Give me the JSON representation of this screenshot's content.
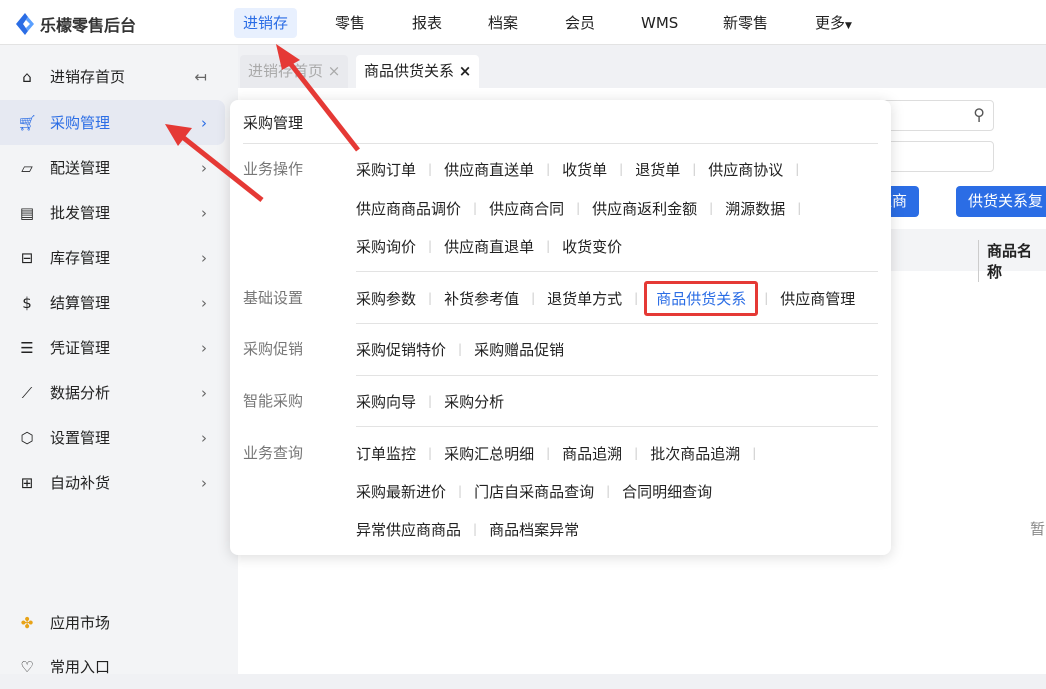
{
  "app": {
    "title": "乐檬零售后台"
  },
  "topnav": [
    "进销存",
    "零售",
    "报表",
    "档案",
    "会员",
    "WMS",
    "新零售",
    "更多"
  ],
  "sidebar": {
    "items": [
      "进销存首页",
      "采购管理",
      "配送管理",
      "批发管理",
      "库存管理",
      "结算管理",
      "凭证管理",
      "数据分析",
      "设置管理",
      "自动补货"
    ],
    "bottom": [
      "应用市场",
      "常用入口"
    ]
  },
  "tabs": [
    "进销存首页",
    "商品供货关系"
  ],
  "background": {
    "buttons": [
      "供应商",
      "供货关系复"
    ],
    "column": "商品名称",
    "empty": "暂"
  },
  "popup": {
    "title": "采购管理",
    "groups": [
      {
        "label": "业务操作",
        "lines": [
          [
            "采购订单",
            "供应商直送单",
            "收货单",
            "退货单",
            "供应商协议"
          ],
          [
            "供应商商品调价",
            "供应商合同",
            "供应商返利金额",
            "溯源数据"
          ],
          [
            "采购询价",
            "供应商直退单",
            "收货变价"
          ]
        ]
      },
      {
        "label": "基础设置",
        "lines": [
          [
            "采购参数",
            "补货参考值",
            "退货单方式",
            "商品供货关系",
            "供应商管理"
          ]
        ]
      },
      {
        "label": "采购促销",
        "lines": [
          [
            "采购促销特价",
            "采购赠品促销"
          ]
        ]
      },
      {
        "label": "智能采购",
        "lines": [
          [
            "采购向导",
            "采购分析"
          ]
        ]
      },
      {
        "label": "业务查询",
        "lines": [
          [
            "订单监控",
            "采购汇总明细",
            "商品追溯",
            "批次商品追溯"
          ],
          [
            "采购最新进价",
            "门店自采商品查询",
            "合同明细查询"
          ],
          [
            "异常供应商商品",
            "商品档案异常"
          ]
        ]
      }
    ]
  },
  "colors": {
    "accent": "#2b6de5",
    "highlight": "#e53935"
  }
}
